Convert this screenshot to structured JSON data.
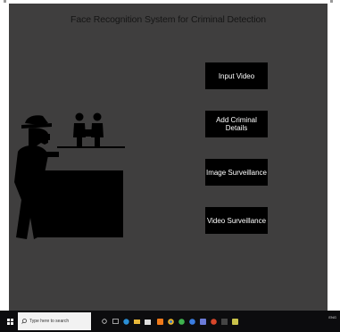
{
  "app": {
    "title": "Face Recognition System for Criminal Detection"
  },
  "buttons": {
    "input_video": "Input Video",
    "add_criminal": "Add Criminal Details",
    "image_surveillance": "Image Surveillance",
    "video_surveillance": "Video Surveillance"
  },
  "taskbar": {
    "search_placeholder": "Type here to search",
    "language": "ENG"
  },
  "colors": {
    "window_bg": "#3f3e3e",
    "button_bg": "#000000",
    "button_text": "#ffffff",
    "title_text": "#151515",
    "taskbar_bg": "#0c0c0e"
  },
  "icons": [
    "windows-start-icon",
    "search-icon",
    "task-view-icon",
    "edge-icon",
    "file-explorer-icon",
    "store-icon",
    "app-icon-orange",
    "app-icon-chrome",
    "app-icon-green",
    "app-icon-blue",
    "app-icon-purple",
    "app-icon-red",
    "app-icon-dark",
    "app-icon-python"
  ]
}
